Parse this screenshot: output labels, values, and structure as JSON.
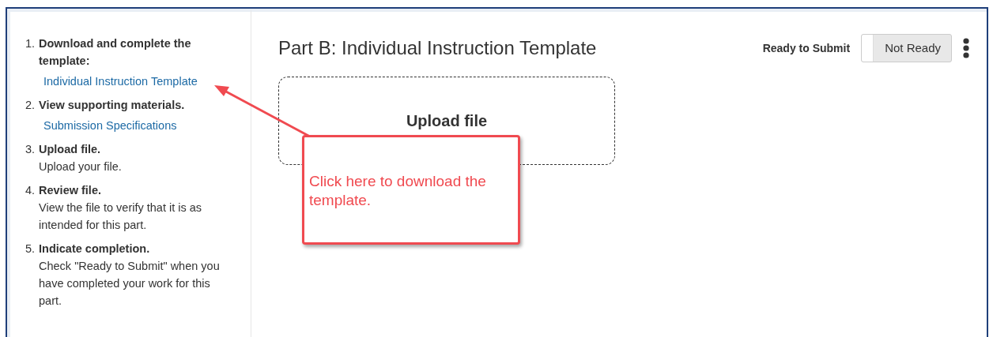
{
  "steps": [
    {
      "number": "1.",
      "title": "Download and complete the template:",
      "link": "Individual Instruction Template"
    },
    {
      "number": "2.",
      "title": "View supporting materials.",
      "link": "Submission Specifications"
    },
    {
      "number": "3.",
      "title": "Upload file.",
      "description": "Upload your file."
    },
    {
      "number": "4.",
      "title": "Review file.",
      "description": "View the file to verify that it is as intended for this part."
    },
    {
      "number": "5.",
      "title": "Indicate completion.",
      "description": "Check \"Ready to Submit\" when you have completed your work for this part."
    }
  ],
  "part_title": "Part B: Individual Instruction Template",
  "ready_toggle": {
    "label": "Ready to Submit",
    "state_text": "Not Ready",
    "on": false
  },
  "upload": {
    "label": "Upload file"
  },
  "callout": {
    "text": "Click here to download the template."
  }
}
